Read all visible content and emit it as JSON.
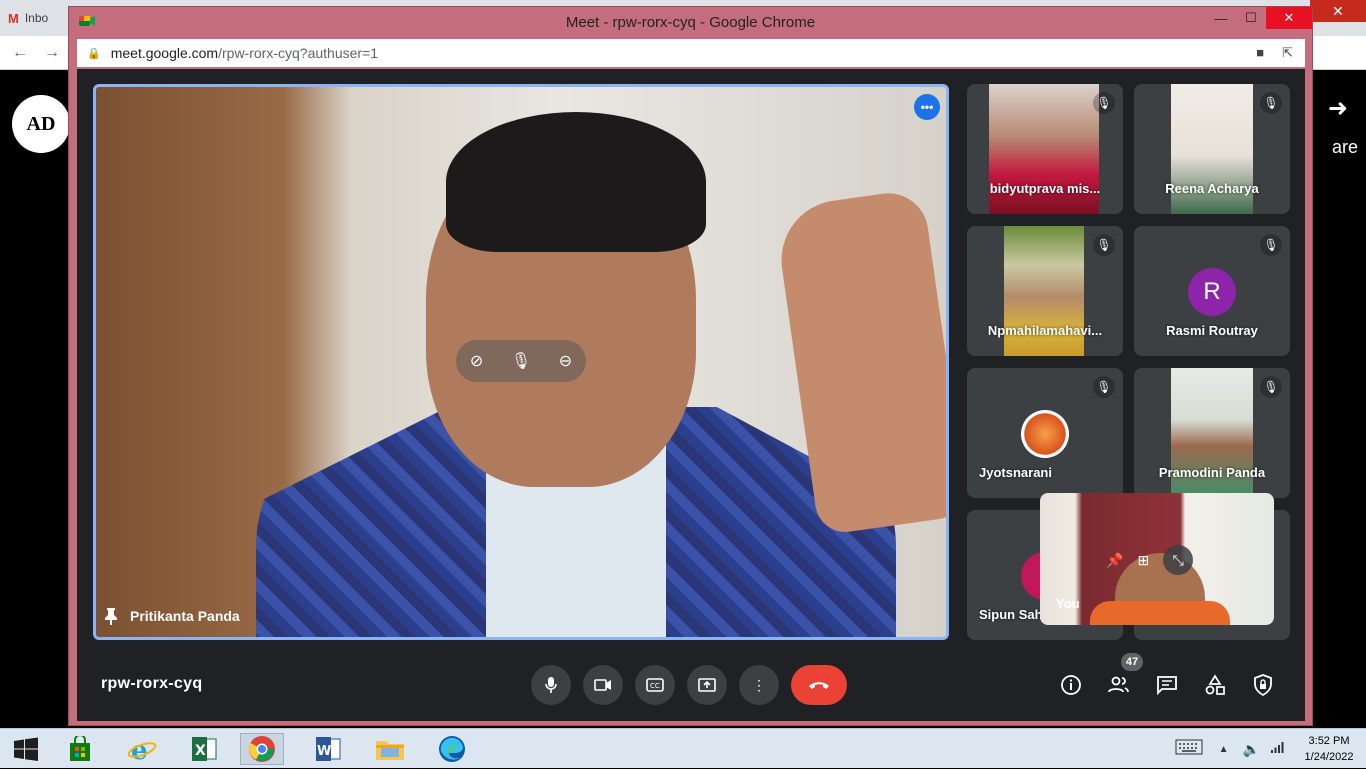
{
  "background": {
    "tab_label": "Inbo",
    "logo_text": "AD",
    "share_text": "are"
  },
  "window": {
    "title": "Meet - rpw-rorx-cyq - Google Chrome",
    "url_host": "meet.google.com",
    "url_path": "/rpw-rorx-cyq?authuser=1"
  },
  "main_tile": {
    "name": "Pritikanta Panda"
  },
  "participants": [
    {
      "name": "bidyutprava mis...",
      "muted": true
    },
    {
      "name": "Reena Acharya",
      "muted": true
    },
    {
      "name": "Npmahilamahavi...",
      "muted": true
    },
    {
      "name": "Rasmi Routray",
      "muted": true,
      "initial": "R",
      "avatar_color": "#8e24aa"
    },
    {
      "name": "Jyotsnarani",
      "muted": true
    },
    {
      "name": "Pramodini Panda",
      "muted": true
    },
    {
      "name": "Sipun Sah",
      "muted": false
    }
  ],
  "self_view": {
    "label": "You"
  },
  "bottom_bar": {
    "meeting_code": "rpw-rorx-cyq",
    "people_count": "47"
  },
  "colors": {
    "meet_bg": "#202124",
    "tile_bg": "#3c4043",
    "end_call": "#ea4335",
    "active_speaker_border": "#8ab4f8",
    "window_frame": "#c46d7d"
  },
  "taskbar": {
    "time": "3:52 PM",
    "date": "1/24/2022",
    "apps": [
      "windows-start",
      "store",
      "internet-explorer",
      "excel",
      "chrome",
      "word",
      "file-explorer",
      "edge"
    ]
  }
}
